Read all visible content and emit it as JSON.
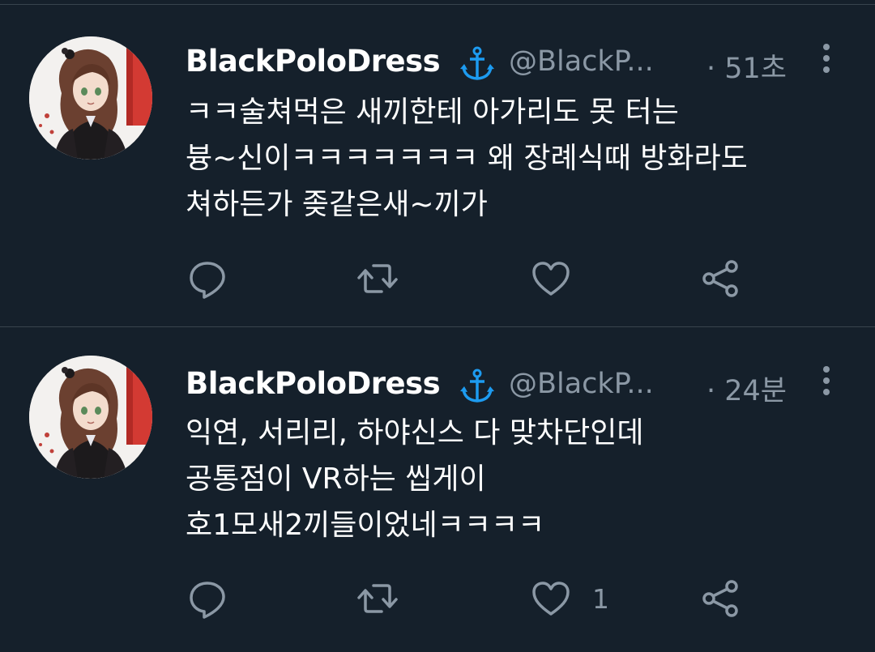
{
  "tweets": [
    {
      "display_name": "BlackPoloDress",
      "badge_icon": "anchor-icon",
      "handle": "@BlackP...",
      "time": "· 51초",
      "text_lines": [
        "ㅋㅋ술쳐먹은 새끼한테 아가리도 못 터는",
        "븅~신이ㅋㅋㅋㅋㅋㅋㅋ 왜 장례식때 방화라도",
        "쳐하든가 좆같은새~끼가"
      ],
      "actions": {
        "reply_count": "",
        "retweet_count": "",
        "like_count": ""
      }
    },
    {
      "display_name": "BlackPoloDress",
      "badge_icon": "anchor-icon",
      "handle": "@BlackP...",
      "time": "· 24분",
      "text_lines": [
        "익연, 서리리, 하야신스 다 맞차단인데",
        "공통점이 VR하는 씹게이",
        "호1모새2끼들이었네ㅋㅋㅋㅋ"
      ],
      "actions": {
        "reply_count": "",
        "retweet_count": "",
        "like_count": "1"
      }
    }
  ],
  "colors": {
    "background": "#15202b",
    "divider": "#38444d",
    "text_primary": "#ffffff",
    "text_secondary": "#8b98a5",
    "badge": "#1d9bf0"
  },
  "icons": [
    "avatar",
    "anchor-icon",
    "more-icon",
    "reply-icon",
    "retweet-icon",
    "like-icon",
    "share-icon"
  ]
}
